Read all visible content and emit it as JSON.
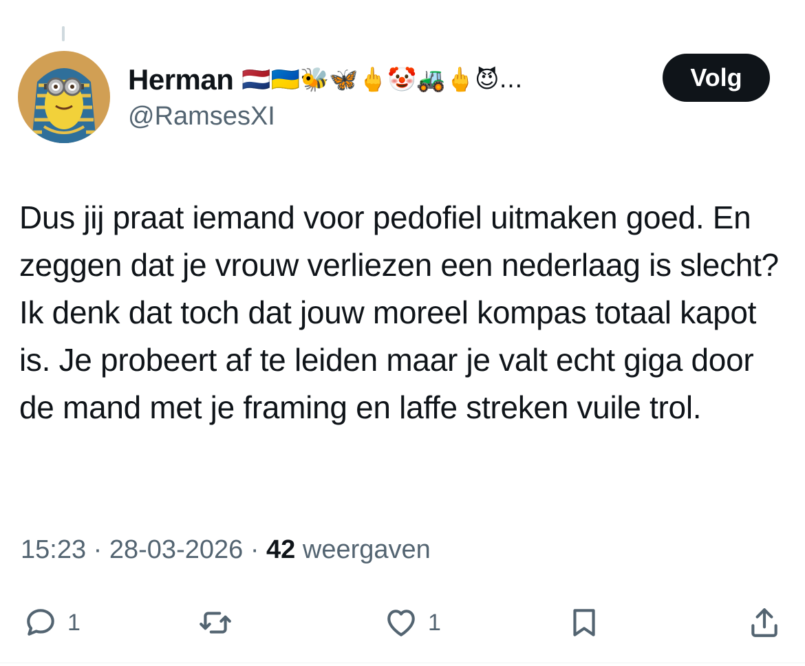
{
  "tweet": {
    "author": {
      "display_name": "Herman",
      "name_emojis": "🇳🇱🇺🇦🐝🦋🖕🤡🚜🖕😈…",
      "handle": "@RamsesXI",
      "avatar_icon": "pharaoh-minion-avatar-icon"
    },
    "follow_label": "Volg",
    "text": "Dus jij praat iemand voor pedofiel uitmaken goed. En zeggen dat je vrouw verliezen een nederlaag is slecht? Ik denk dat toch dat jouw moreel kompas totaal kapot is. Je probeert af te leiden maar je valt echt giga door de mand met je framing en laffe streken vuile trol.",
    "time": "15:23",
    "separator": "·",
    "date": "28-03-2026",
    "views_count": "42",
    "views_label": "weergaven",
    "actions": {
      "reply": {
        "icon": "reply-icon",
        "count": "1"
      },
      "retweet": {
        "icon": "retweet-icon",
        "count": ""
      },
      "like": {
        "icon": "heart-icon",
        "count": "1"
      },
      "bookmark": {
        "icon": "bookmark-icon"
      },
      "share": {
        "icon": "share-icon"
      }
    }
  },
  "colors": {
    "text": "#0f1419",
    "secondary": "#536471",
    "button_bg": "#0f1419",
    "button_text": "#ffffff"
  }
}
